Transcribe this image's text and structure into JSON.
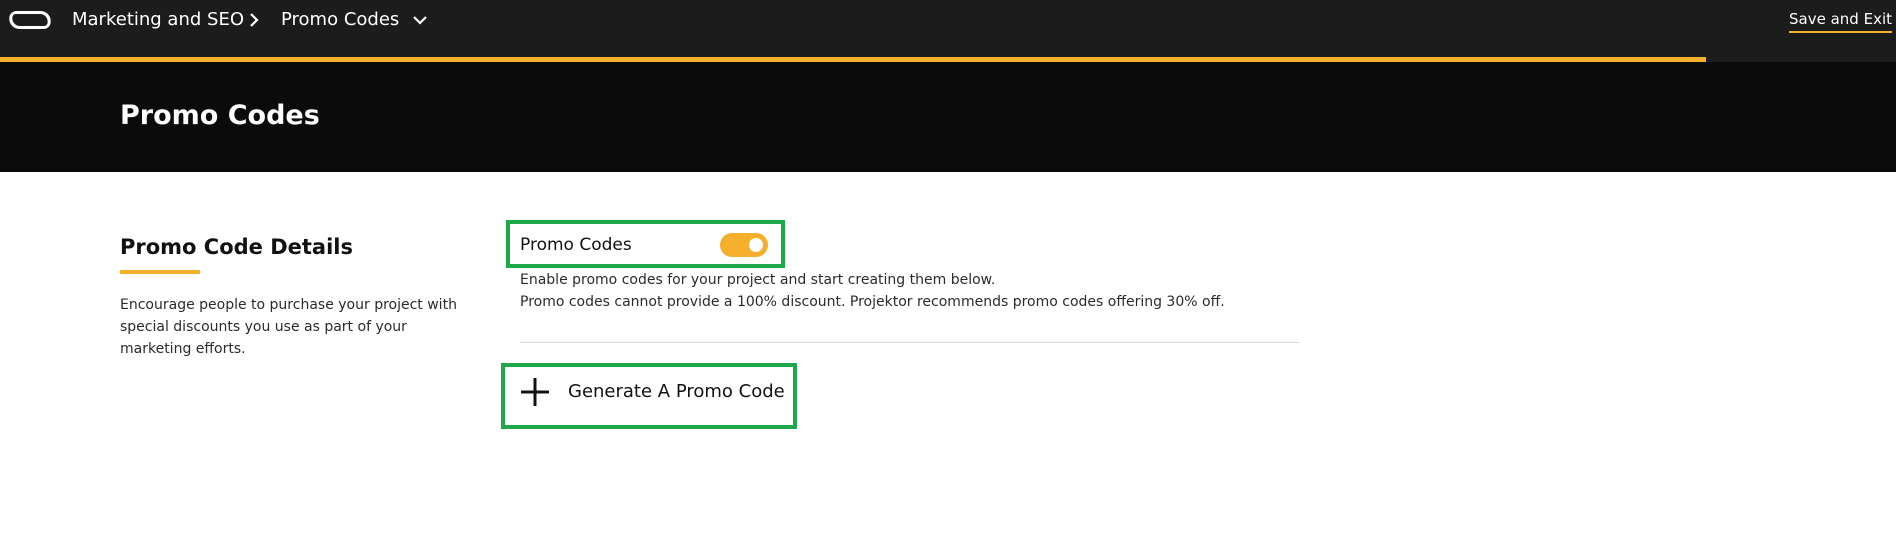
{
  "topbar": {
    "logo_icon": "projektor-logo-icon",
    "breadcrumb": [
      "Marketing and SEO",
      "Promo Codes"
    ],
    "separator_icon": "chevron-right-icon",
    "dropdown_icon": "chevron-down-icon",
    "save_exit_label": "Save and Exit",
    "progress": 0.9,
    "accent_color": "#f6ae2d"
  },
  "hero": {
    "title": "Promo Codes"
  },
  "details": {
    "title": "Promo Code Details",
    "description": "Encourage people to purchase your project with special discounts you use as part of your marketing efforts."
  },
  "promo_toggle": {
    "label": "Promo Codes",
    "enabled": true,
    "help_line_1": "Enable promo codes for your project and start creating them below.",
    "help_line_2": "Promo codes cannot provide a 100% discount. Projektor recommends promo codes offering 30% off."
  },
  "generate": {
    "icon": "plus-icon",
    "label": "Generate A Promo Code"
  },
  "highlight_color": "#1fa84a"
}
